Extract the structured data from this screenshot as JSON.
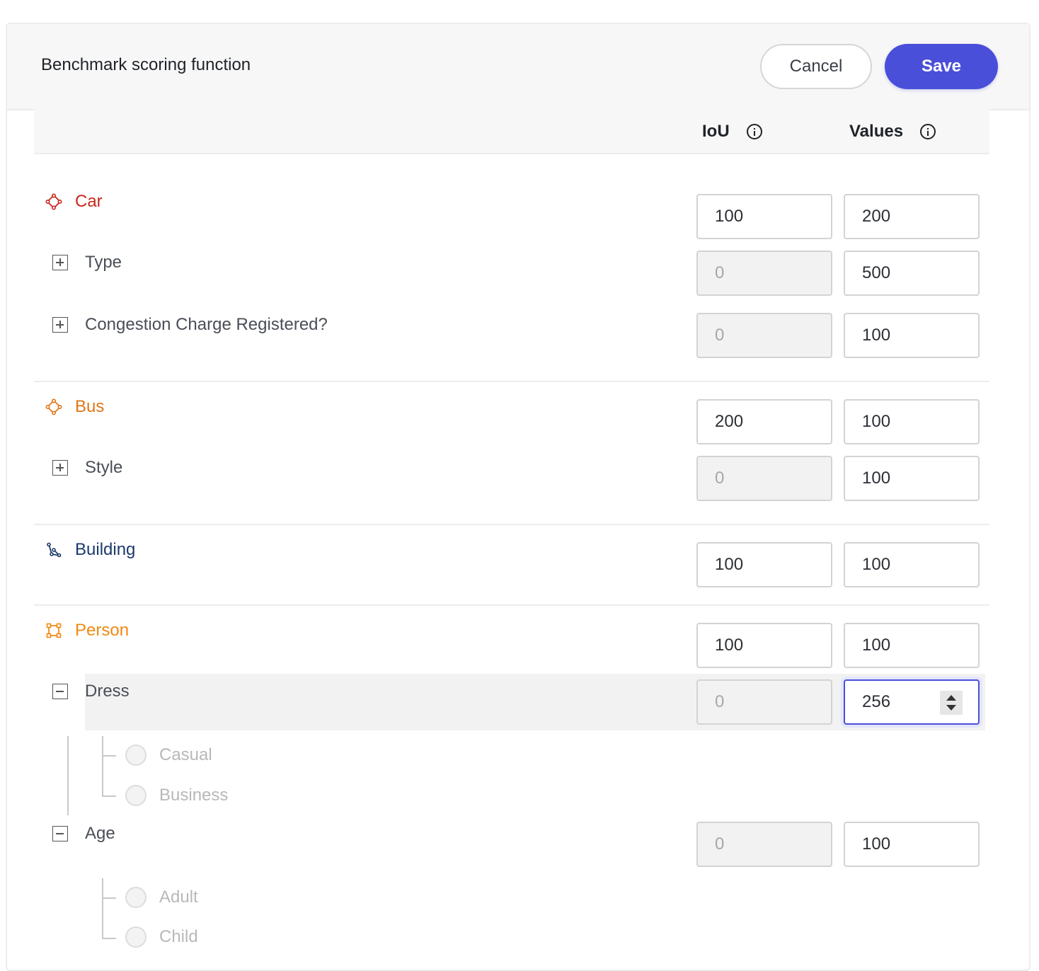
{
  "header": {
    "title": "Benchmark scoring function",
    "cancel_label": "Cancel",
    "save_label": "Save"
  },
  "columns": {
    "iou": "IoU",
    "values": "Values"
  },
  "colors": {
    "accent": "#4a4fd9",
    "car": "#c8281d",
    "bus": "#e0771a",
    "building": "#1c3a6b",
    "person": "#f08a12"
  },
  "classes": {
    "car": {
      "label": "Car",
      "icon": "polygon-icon",
      "iou": "100",
      "values": "200",
      "attributes": {
        "type": {
          "label": "Type",
          "iou": "0",
          "values": "500"
        },
        "congestion": {
          "label": "Congestion Charge Registered?",
          "iou": "0",
          "values": "100"
        }
      }
    },
    "bus": {
      "label": "Bus",
      "icon": "polygon-icon",
      "iou": "200",
      "values": "100",
      "attributes": {
        "style": {
          "label": "Style",
          "iou": "0",
          "values": "100"
        }
      }
    },
    "building": {
      "label": "Building",
      "icon": "polyline-icon",
      "iou": "100",
      "values": "100"
    },
    "person": {
      "label": "Person",
      "icon": "bounding-box-icon",
      "iou": "100",
      "values": "100",
      "attributes": {
        "dress": {
          "label": "Dress",
          "iou": "0",
          "values": "256",
          "options": [
            "Casual",
            "Business"
          ]
        },
        "age": {
          "label": "Age",
          "iou": "0",
          "values": "100",
          "options": [
            "Adult",
            "Child"
          ]
        }
      }
    }
  }
}
